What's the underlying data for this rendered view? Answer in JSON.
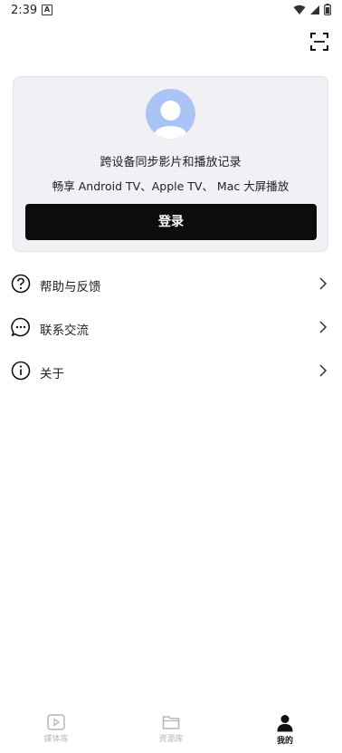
{
  "status_bar": {
    "time": "2:39",
    "notification_letter": "A"
  },
  "account_card": {
    "line1": "跨设备同步影片和播放记录",
    "line2": "畅享 Android TV、Apple TV、 Mac 大屏播放",
    "login_label": "登录"
  },
  "menu": [
    {
      "label": "帮助与反馈",
      "icon": "question-circle-icon"
    },
    {
      "label": "联系交流",
      "icon": "chat-bubble-icon"
    },
    {
      "label": "关于",
      "icon": "info-circle-icon"
    }
  ],
  "tabs": [
    {
      "label": "媒体库",
      "icon": "play-square-icon",
      "active": false
    },
    {
      "label": "资源库",
      "icon": "folder-icon",
      "active": false
    },
    {
      "label": "我的",
      "icon": "person-icon",
      "active": true
    }
  ],
  "colors": {
    "card_bg": "#f1f1f5",
    "button_bg": "#0c0c0c",
    "avatar_bg": "#a9c4f5",
    "inactive_tab": "#b5b5b5"
  }
}
